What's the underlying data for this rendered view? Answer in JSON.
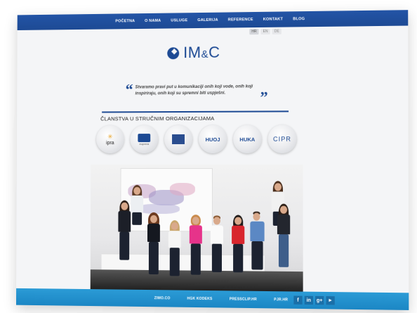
{
  "nav": {
    "items": [
      "POČETNA",
      "O NAMA",
      "USLUGE",
      "GALERIJA",
      "REFERENCE",
      "KONTAKT",
      "BLOG"
    ]
  },
  "languages": [
    "HR",
    "EN",
    "DE"
  ],
  "logo": {
    "main": "IM",
    "amp": "&",
    "end": "C"
  },
  "quote": {
    "open": "“",
    "close": "”",
    "text": "Stvaramo pravi put u komunikaciji onih koji vode, onih koji inspiriraju, onih koji su spremni biti uspješni."
  },
  "members": {
    "title": "ČLANSTVA U STRUČNIM ORGANIZACIJAMA",
    "badges": [
      {
        "label": "ipra",
        "kind": "ipra"
      },
      {
        "label": "euprera",
        "kind": "euprera"
      },
      {
        "label": "",
        "kind": "fed"
      },
      {
        "label": "HUOJ",
        "kind": "text"
      },
      {
        "label": "HUKA",
        "kind": "text"
      },
      {
        "label": "CIPR",
        "kind": "cipr"
      }
    ]
  },
  "footer": {
    "links": [
      "ZIMO.CO",
      "HGK KODEKS",
      "PRESSCLIP.HR",
      "PJR.HR"
    ],
    "social": [
      {
        "icon": "facebook-icon",
        "glyph": "f"
      },
      {
        "icon": "linkedin-icon",
        "glyph": "in"
      },
      {
        "icon": "google-plus-icon",
        "glyph": "g+"
      },
      {
        "icon": "youtube-icon",
        "glyph": "▶"
      }
    ]
  },
  "colors": {
    "brand": "#1d4a94",
    "footer": "#2b9bd6"
  }
}
